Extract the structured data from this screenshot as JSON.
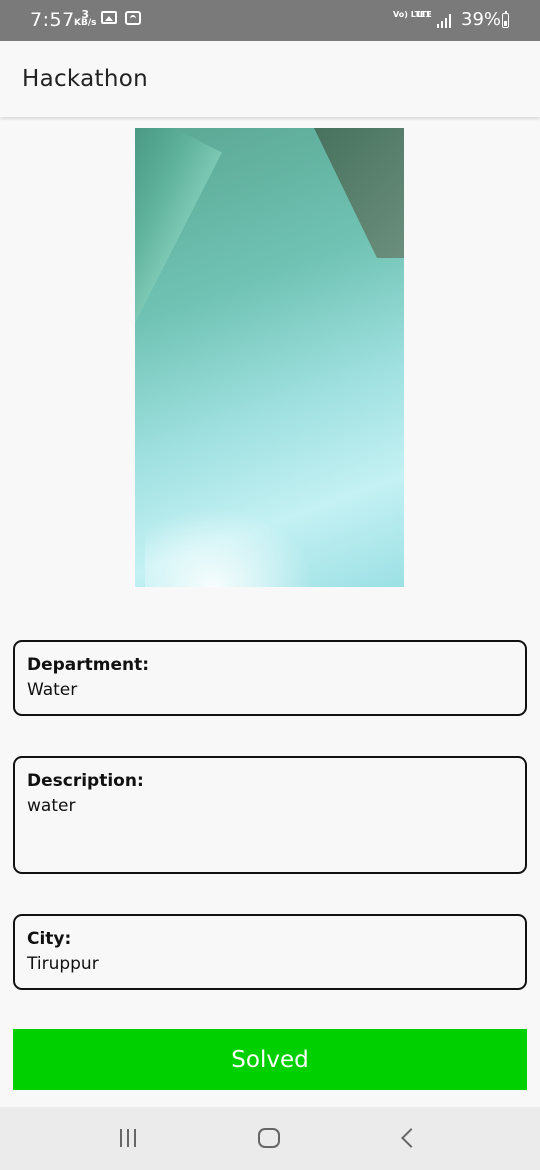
{
  "status_bar": {
    "time": "7:57",
    "net_speed_value": "3",
    "net_speed_unit": "KB/s",
    "volte_label": "Vo) LTE1",
    "lte_label": "LTE",
    "battery_percent": "39%",
    "icons": [
      "gallery-icon",
      "wifi-icon",
      "signal-icon",
      "battery-icon"
    ]
  },
  "app_bar": {
    "title": "Hackathon"
  },
  "report": {
    "department_label": "Department:",
    "department_value": "Water",
    "description_label": "Description:",
    "description_value": "water",
    "city_label": "City:",
    "city_value": "Tiruppur"
  },
  "action": {
    "solved_label": "Solved",
    "color": "#00d000"
  },
  "nav_bar": {
    "icons": [
      "recents-icon",
      "home-icon",
      "back-icon"
    ]
  }
}
